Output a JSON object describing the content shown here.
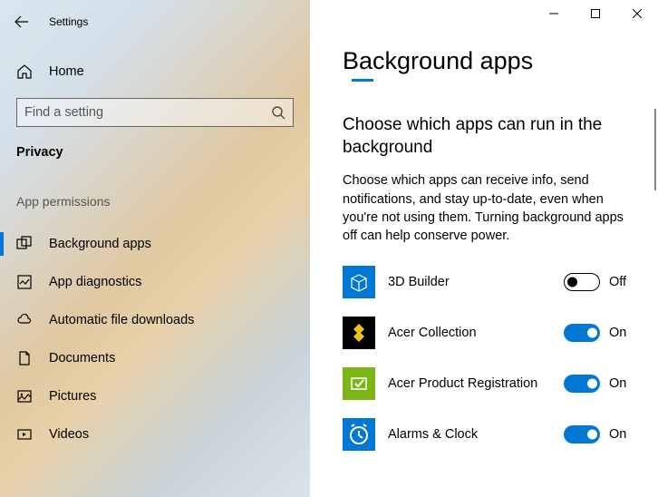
{
  "window": {
    "title": "Settings"
  },
  "sidebar": {
    "home": "Home",
    "search_placeholder": "Find a setting",
    "category": "Privacy",
    "group_label": "App permissions",
    "items": [
      {
        "label": "Background apps",
        "selected": true
      },
      {
        "label": "App diagnostics",
        "selected": false
      },
      {
        "label": "Automatic file downloads",
        "selected": false
      },
      {
        "label": "Documents",
        "selected": false
      },
      {
        "label": "Pictures",
        "selected": false
      },
      {
        "label": "Videos",
        "selected": false
      }
    ]
  },
  "main": {
    "title": "Background apps",
    "subheading": "Choose which apps can run in the background",
    "body": "Choose which apps can receive info, send notifications, and stay up-to-date, even when you're not using them. Turning background apps off can help conserve power.",
    "apps": [
      {
        "name": "3D Builder",
        "on": false,
        "state": "Off"
      },
      {
        "name": "Acer Collection",
        "on": true,
        "state": "On"
      },
      {
        "name": "Acer Product Registration",
        "on": true,
        "state": "On"
      },
      {
        "name": "Alarms & Clock",
        "on": true,
        "state": "On"
      }
    ]
  }
}
